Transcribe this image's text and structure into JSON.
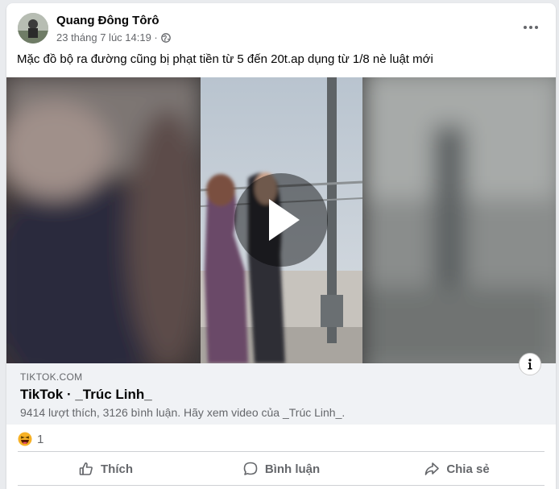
{
  "post": {
    "author": "Quang Đông Tôrô",
    "timestamp": "23 tháng 7 lúc 14:19 ·",
    "privacy_icon": "globe-icon",
    "caption": "Mặc đồ bộ ra đường cũng bị phạt tiền từ 5 đến 20t.ap dụng từ 1/8 nè luật mới"
  },
  "link_preview": {
    "domain": "TIKTOK.COM",
    "title": "TikTok · _Trúc Linh_",
    "description": "9414 lượt thích, 3126 bình luận. Hãy xem video của _Trúc Linh_."
  },
  "reactions": {
    "icon": "haha-reaction-icon",
    "count": "1"
  },
  "actions": {
    "like_label": "Thích",
    "comment_label": "Bình luận",
    "share_label": "Chia sẻ"
  },
  "colors": {
    "secondary_text": "#65676b",
    "link_box_bg": "#f0f2f5",
    "haha_yellow": "#f7b125"
  }
}
